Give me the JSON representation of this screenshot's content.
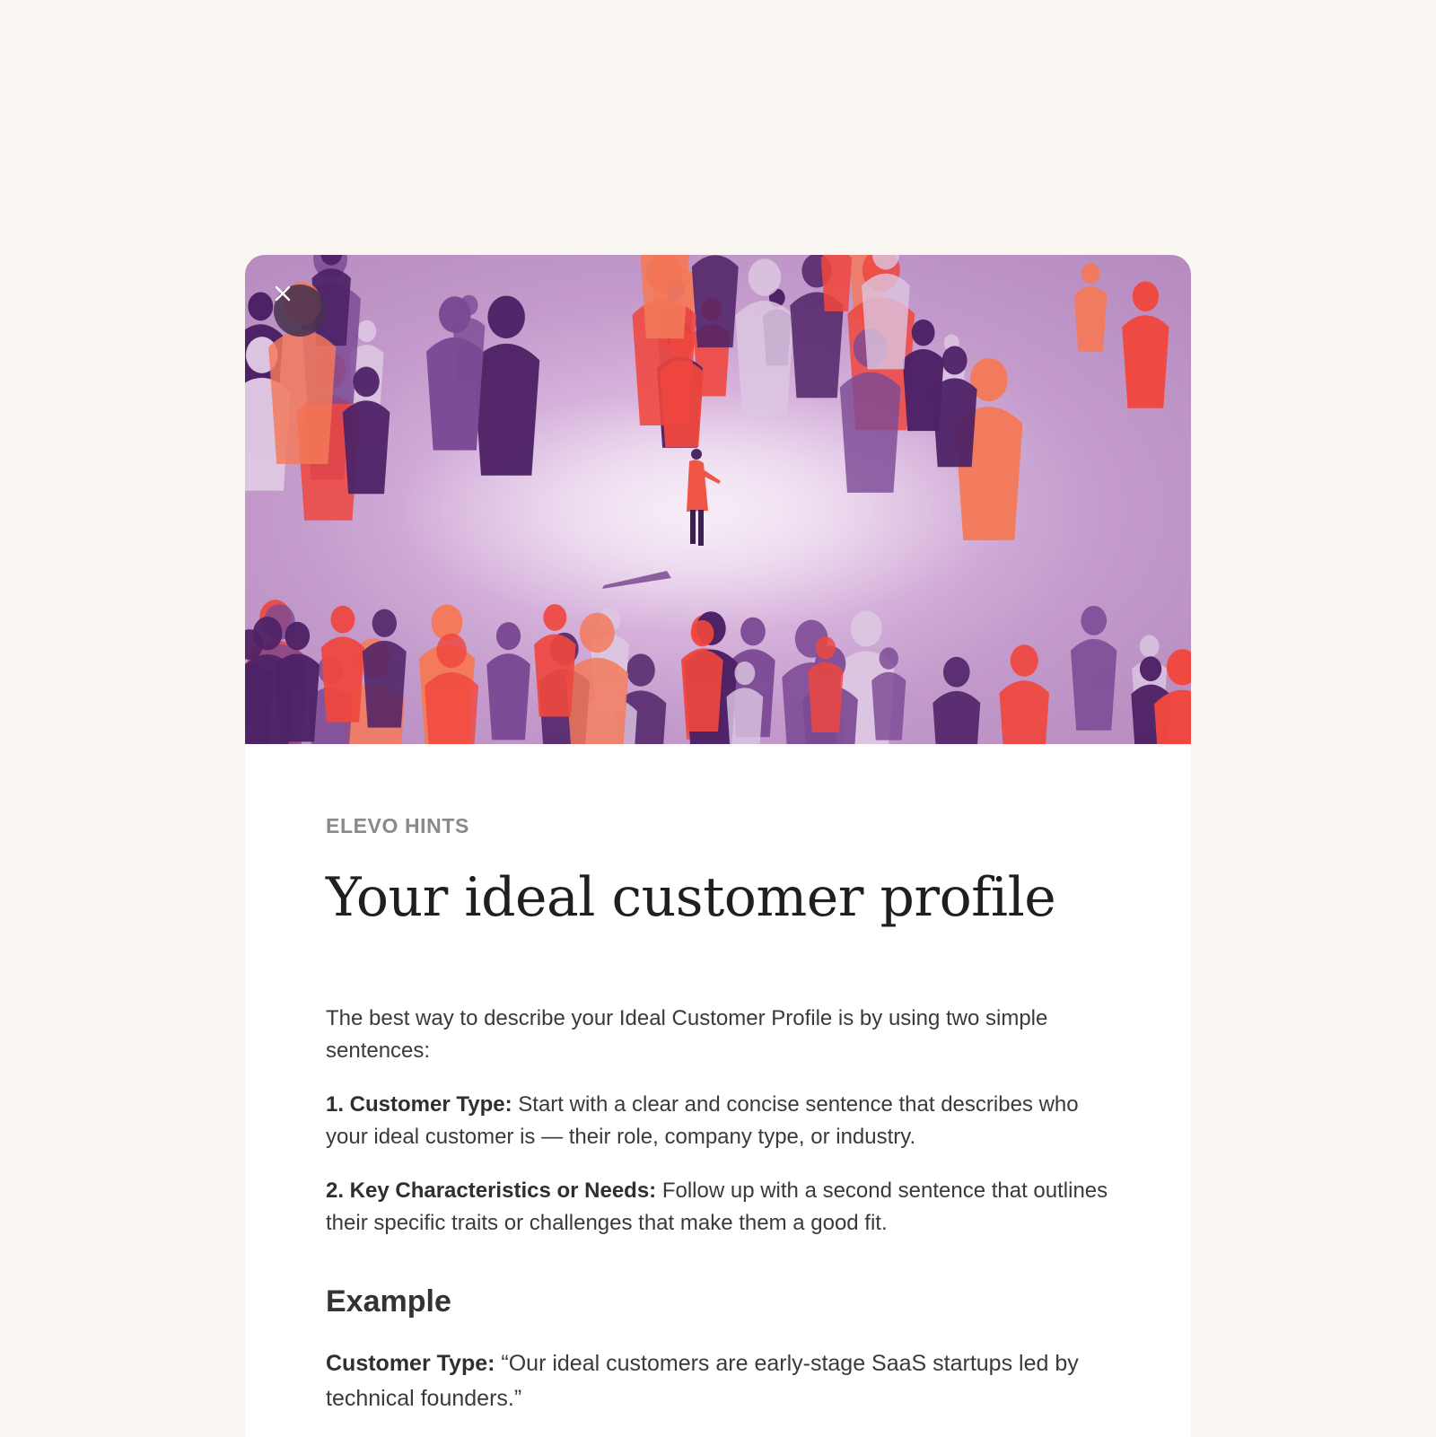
{
  "colors": {
    "page_background": "#f9f5f0",
    "card_background": "#ffffff",
    "hero_lilac": "#c9a4d0",
    "figure_dark_purple": "#4e2266",
    "figure_purple": "#7c4a95",
    "figure_light_purple": "#dcc6e2",
    "figure_red": "#f0473e",
    "figure_orange": "#f47a5a"
  },
  "hero": {
    "close_icon": "close-icon"
  },
  "hint": {
    "eyebrow": "ELEVO HINTS",
    "title": "Your ideal customer profile",
    "intro": "The best way to describe your Ideal Customer Profile is by using two simple sentences:",
    "items": [
      {
        "label": "1. Customer Type:",
        "text": " Start with a clear and concise sentence that describes who your ideal customer is — their role, company type, or industry."
      },
      {
        "label": "2. Key Characteristics or Needs:",
        "text": " Follow up with a second sentence that outlines their specific traits or challenges that make them a good fit."
      }
    ],
    "example_heading": "Example",
    "example": {
      "label": "Customer Type:",
      "text": " “Our ideal customers are early-stage SaaS startups led by technical founders.”"
    }
  }
}
